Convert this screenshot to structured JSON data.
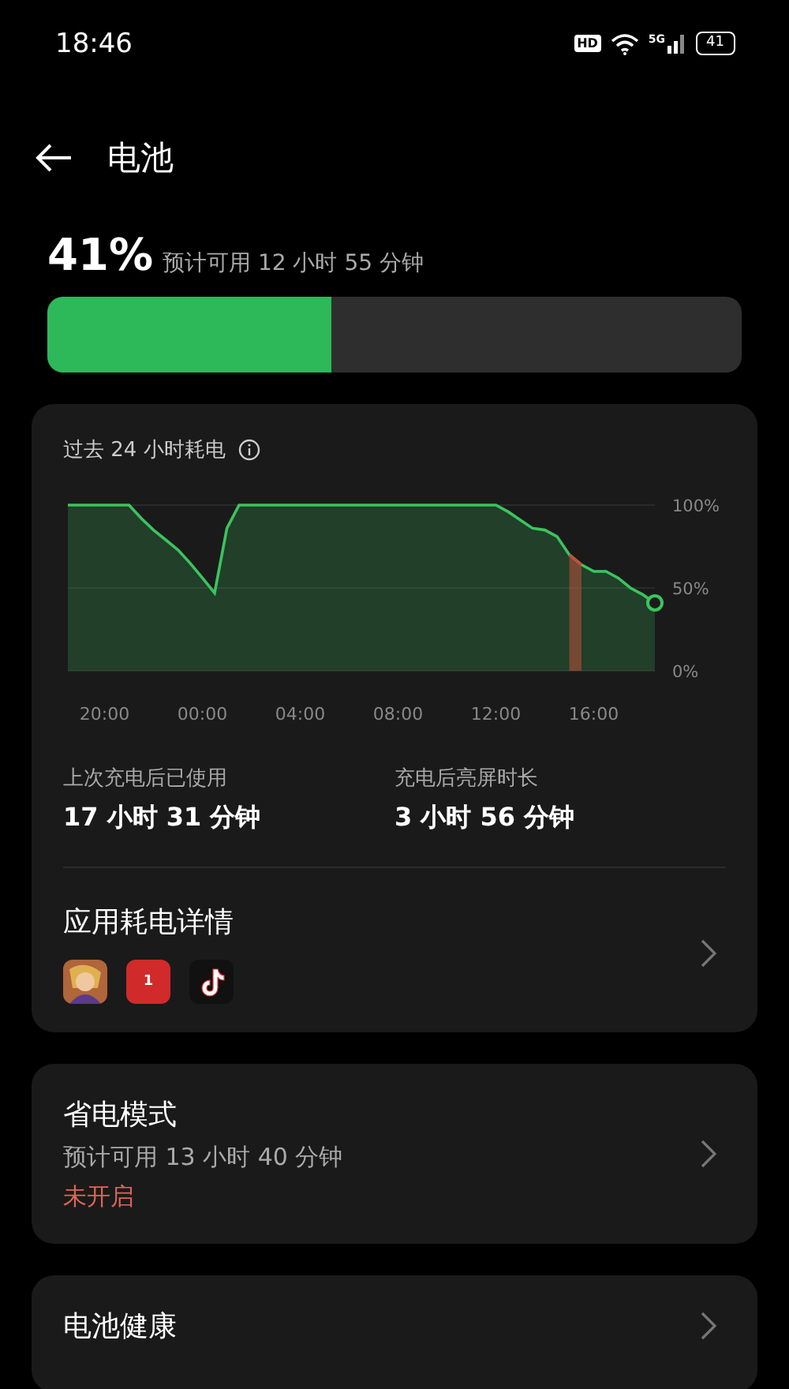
{
  "status_bar": {
    "time": "18:46",
    "hd": "HD",
    "network": "5G",
    "battery": "41"
  },
  "header": {
    "title": "电池"
  },
  "battery": {
    "percent": "41%",
    "estimate": "预计可用 12 小时 55 分钟",
    "level": 0.41
  },
  "usage_card": {
    "title": "过去 24 小时耗电",
    "chart_data": {
      "type": "area",
      "categories": [
        null,
        null,
        null,
        "20:00",
        null,
        null,
        null,
        null,
        null,
        null,
        null,
        "00:00",
        null,
        null,
        null,
        null,
        null,
        null,
        null,
        "04:00",
        null,
        null,
        null,
        null,
        null,
        null,
        null,
        "08:00",
        null,
        null,
        null,
        null,
        null,
        null,
        null,
        "12:00",
        null,
        null,
        null,
        null,
        null,
        null,
        null,
        "16:00",
        null,
        null,
        null,
        null,
        null
      ],
      "series": [
        {
          "color": "#c0503a",
          "values": [
            null,
            null,
            null,
            null,
            null,
            null,
            null,
            null,
            null,
            null,
            null,
            null,
            null,
            null,
            null,
            null,
            null,
            null,
            null,
            null,
            null,
            null,
            null,
            null,
            null,
            null,
            null,
            null,
            null,
            null,
            null,
            null,
            null,
            null,
            null,
            null,
            null,
            null,
            null,
            null,
            null,
            70,
            64,
            null,
            null,
            null,
            null,
            null,
            null
          ]
        },
        {
          "color": "#3cc35f",
          "values": [
            100,
            100,
            100,
            100,
            100,
            100,
            92,
            85,
            79,
            73,
            65,
            56,
            47,
            86,
            100,
            100,
            100,
            100,
            100,
            100,
            100,
            100,
            100,
            100,
            100,
            100,
            100,
            100,
            100,
            100,
            100,
            100,
            100,
            100,
            100,
            100,
            96,
            91,
            86,
            85,
            81,
            70,
            64,
            60,
            60,
            56,
            50,
            46,
            41
          ]
        }
      ],
      "ylim": [
        0,
        100
      ],
      "yticks": [
        {
          "value": 100,
          "label": "100%"
        },
        {
          "value": 50,
          "label": "50%"
        },
        {
          "value": 0,
          "label": "0%"
        }
      ]
    },
    "stats": [
      {
        "label": "上次充电后已使用",
        "value": "17 小时 31 分钟"
      },
      {
        "label": "充电后亮屏时长",
        "value": "3 小时 56 分钟"
      }
    ],
    "app_details": {
      "title": "应用耗电详情",
      "apps": [
        {
          "kind": "figure"
        },
        {
          "kind": "badge",
          "badge": "1"
        },
        {
          "kind": "note"
        }
      ]
    }
  },
  "power_saving": {
    "title": "省电模式",
    "estimate": "预计可用 13 小时 40 分钟",
    "status": "未开启",
    "on": false
  },
  "battery_health": {
    "title": "电池健康"
  }
}
